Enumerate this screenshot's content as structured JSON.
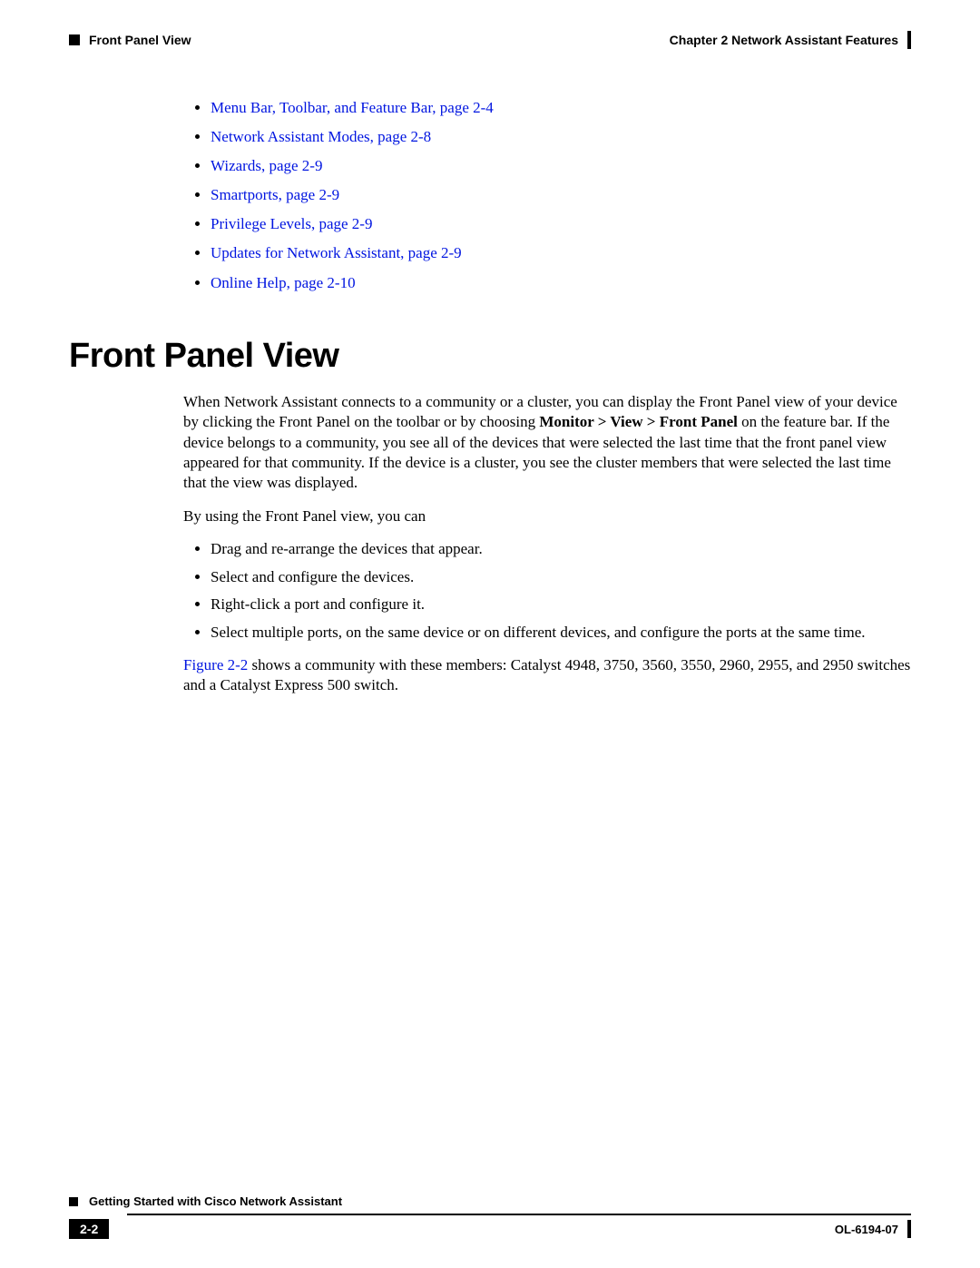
{
  "header": {
    "left_section": "Front Panel View",
    "right_chapter": "Chapter 2      Network Assistant Features"
  },
  "toc": [
    "Menu Bar, Toolbar, and Feature Bar, page 2-4",
    "Network Assistant Modes, page 2-8",
    "Wizards, page 2-9",
    "Smartports, page 2-9",
    "Privilege Levels, page 2-9",
    "Updates for Network Assistant, page 2-9",
    "Online Help, page 2-10"
  ],
  "heading": "Front Panel View",
  "para1_a": "When Network Assistant connects to a community or a cluster, you can display the Front Panel view of your device by clicking the Front Panel on the toolbar or by choosing ",
  "para1_bold": "Monitor > View > Front Panel",
  "para1_b": " on the feature bar. If the device belongs to a community, you see all of the devices that were selected the last time that the front panel view appeared for that community. If the device is a cluster, you see the cluster members that were selected the last time that the view was displayed.",
  "para2": "By using the Front Panel view, you can",
  "bullets": [
    "Drag and re-arrange the devices that appear.",
    "Select and configure the devices.",
    "Right-click a port and configure it.",
    "Select multiple ports, on the same device or on different devices, and configure the ports at the same time."
  ],
  "para3_link": "Figure 2-2",
  "para3_rest": " shows a community with these members: Catalyst 4948, 3750, 3560, 3550, 2960, 2955, and 2950 switches and a Catalyst Express 500 switch.",
  "footer": {
    "book_title": "Getting Started with Cisco Network Assistant",
    "page_badge": "2-2",
    "doc_id": "OL-6194-07"
  }
}
